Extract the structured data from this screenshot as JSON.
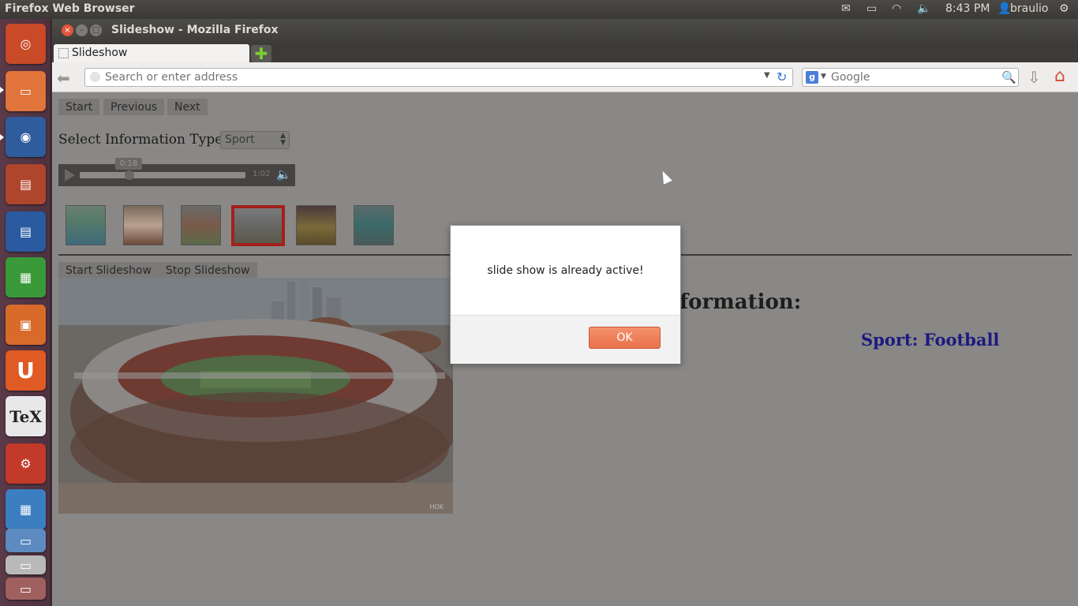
{
  "top_panel": {
    "app_title": "Firefox Web Browser",
    "clock": "8:43 PM",
    "user": "braulio"
  },
  "window": {
    "title": "Slideshow - Mozilla Firefox"
  },
  "tabs": [
    {
      "label": "Slideshow"
    }
  ],
  "navbar": {
    "url_placeholder": "Search or enter address",
    "search_placeholder": "Google"
  },
  "page": {
    "nav_buttons": {
      "start": "Start",
      "previous": "Previous",
      "next": "Next"
    },
    "select_label": "Select Information Type:",
    "select_value": "Sport",
    "audio": {
      "current": "0:18",
      "duration": "1:02",
      "progress_fraction": 0.3
    },
    "slideshow_buttons": {
      "start": "Start Slideshow",
      "stop": "Stop Slideshow"
    },
    "info_heading": "formation:",
    "info_value": "Sport: Football",
    "selected_thumbnail_index": 3,
    "watermark": "HOK"
  },
  "dialog": {
    "message": "slide show is already active!",
    "ok_label": "OK"
  },
  "colors": {
    "accent_ok": "#e9714a",
    "selected_thumb_border": "#a3201b",
    "info_value": "#1a1a80"
  }
}
